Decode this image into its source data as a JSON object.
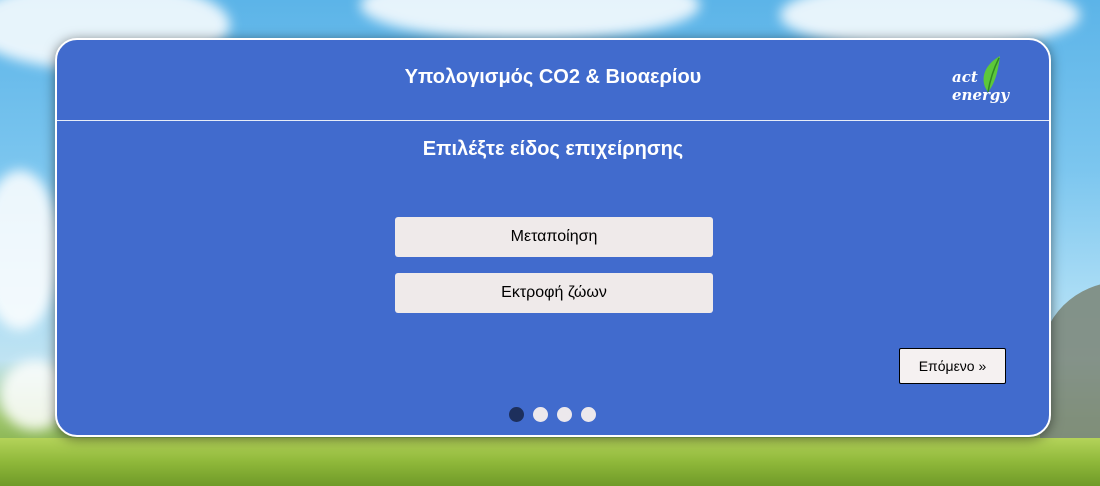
{
  "header": {
    "title": "Υπολογισμός CO2 & Βιοαερίου",
    "logo": {
      "text_left": "act",
      "text_right": "energy",
      "leaf_color": "#5cc83a"
    }
  },
  "step": {
    "prompt": "Επιλέξτε είδος επιχείρησης",
    "options": [
      {
        "label": "Μεταποίηση"
      },
      {
        "label": "Εκτροφή ζώων"
      }
    ],
    "next_label": "Επόμενο »"
  },
  "pagination": {
    "total": 4,
    "current": 1
  },
  "colors": {
    "card": "#416bcd",
    "option_bg": "#efeaea",
    "dot_active": "#1d2f5c",
    "dot_inactive": "#ece8ec"
  }
}
